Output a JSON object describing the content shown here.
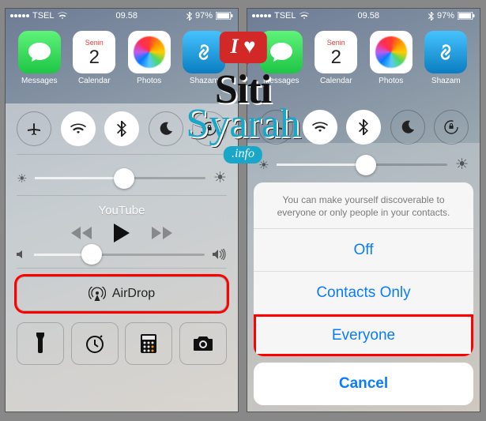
{
  "status": {
    "carrier": "TSEL",
    "time": "09.58",
    "battery_pct": "97%"
  },
  "homescreen": {
    "cal_day_name": "Senin",
    "cal_day_num": "2",
    "app_messages": "Messages",
    "app_calendar": "Calendar",
    "app_photos": "Photos",
    "app_shazam": "Shazam"
  },
  "cc": {
    "nowplaying": "YouTube",
    "airdrop_label": "AirDrop",
    "brightness_value_pct": 52,
    "volume_value_pct": 34
  },
  "sheet": {
    "message": "You can make yourself discoverable to everyone or only people in your contacts.",
    "opt_off": "Off",
    "opt_contacts": "Contacts Only",
    "opt_everyone": "Everyone",
    "cancel": "Cancel"
  },
  "watermark": {
    "top": "I ♥",
    "line1": "Siti",
    "line2": "Syarah",
    "info": ".info"
  },
  "icons": {
    "airplane": "airplane-icon",
    "wifi": "wifi-icon",
    "bluetooth": "bluetooth-icon",
    "dnd": "moon-icon",
    "lock": "orientation-lock-icon",
    "airdrop": "airdrop-icon",
    "flashlight": "flashlight-icon",
    "timer": "timer-icon",
    "calculator": "calculator-icon",
    "camera": "camera-icon"
  }
}
